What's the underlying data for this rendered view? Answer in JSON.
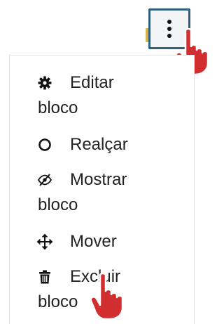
{
  "header": {
    "actions_button": {
      "icon": "kebab-vertical-icon"
    }
  },
  "menu": {
    "items": [
      {
        "icon": "gear-icon",
        "line1": "Editar",
        "line2": "bloco"
      },
      {
        "icon": "circle-icon",
        "line1": "Realçar",
        "line2": ""
      },
      {
        "icon": "eye-slash-icon",
        "line1": "Mostrar",
        "line2": "bloco"
      },
      {
        "icon": "move-arrows-icon",
        "line1": "Mover",
        "line2": ""
      },
      {
        "icon": "trash-icon",
        "line1": "Excluir",
        "line2": "bloco"
      }
    ]
  },
  "colors": {
    "button_border": "#2f5f7f",
    "accent_stub": "#d9b24a",
    "cursor_red": "#d12f2f"
  }
}
